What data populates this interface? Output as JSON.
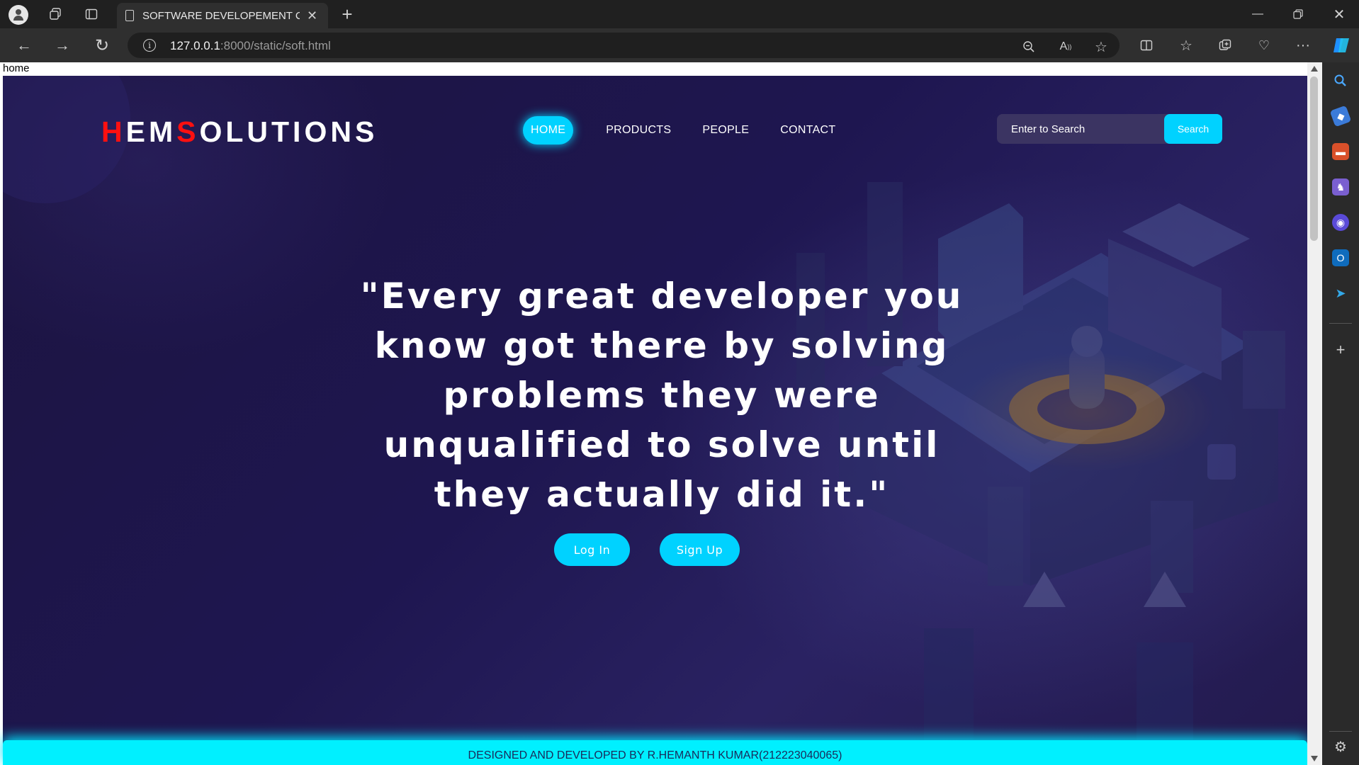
{
  "browser": {
    "tab_title": "SOFTWARE DEVELOPEMENT COI",
    "url_host": "127.0.0.1",
    "url_path": ":8000/static/soft.html",
    "info_glyph": "i"
  },
  "page": {
    "skip_text": "home",
    "logo": {
      "h": "H",
      "em": "EM",
      "s": "S",
      "olutions": "OLUTIONS"
    },
    "nav": [
      {
        "label": "HOME",
        "active": true
      },
      {
        "label": "PRODUCTS"
      },
      {
        "label": "PEOPLE"
      },
      {
        "label": "CONTACT"
      }
    ],
    "search": {
      "placeholder": "Enter to Search",
      "button": "Search"
    },
    "quote": "\"Every great developer you know got there by solving problems they were unqualified to solve until they actually did it.\"",
    "buttons": {
      "login": "Log In",
      "signup": "Sign Up"
    },
    "footer": "DESIGNED AND DEVELOPED BY R.HEMANTH KUMAR(212223040065)"
  },
  "colors": {
    "accent": "#00d2ff",
    "logo_red": "#ff1010",
    "hero_bg": "#1e1650",
    "footer_bg": "#00f0ff"
  },
  "icons": [
    "profile-icon",
    "workspaces-icon",
    "tab-actions-icon",
    "document-icon",
    "close-icon",
    "new-tab-icon",
    "minimize-icon",
    "restore-icon",
    "window-close-icon",
    "back-icon",
    "forward-icon",
    "refresh-icon",
    "info-icon",
    "zoom-out-icon",
    "read-aloud-icon",
    "favorite-star-icon",
    "split-screen-icon",
    "favorites-icon",
    "collections-icon",
    "browser-essentials-icon",
    "more-icon",
    "copilot-icon",
    "search-sidebar-icon",
    "shopping-tag-icon",
    "tools-icon",
    "games-icon",
    "microsoft365-icon",
    "outlook-icon",
    "drop-icon",
    "add-icon",
    "settings-icon"
  ]
}
